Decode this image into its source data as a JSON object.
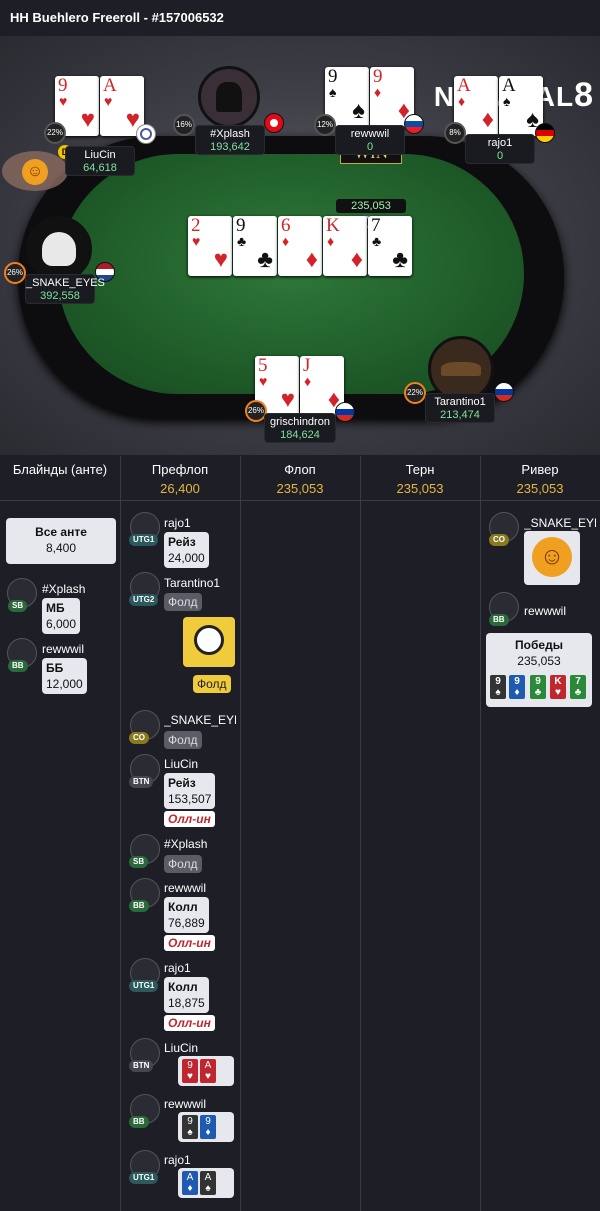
{
  "title": "HH Buehlero Freeroll - #157006532",
  "logo": {
    "text": "NATURAL",
    "digit": "8"
  },
  "table": {
    "win_label": "WIN",
    "pot": "235,053",
    "board": [
      {
        "rank": "2",
        "suit": "♥",
        "color": "red"
      },
      {
        "rank": "9",
        "suit": "♣",
        "color": "blk"
      },
      {
        "rank": "6",
        "suit": "♦",
        "color": "red"
      },
      {
        "rank": "K",
        "suit": "♦",
        "color": "red"
      },
      {
        "rank": "7",
        "suit": "♣",
        "color": "blk"
      }
    ],
    "players": [
      {
        "name": "LiuCin",
        "stack": "64,618",
        "pct": "22%",
        "cards": [
          {
            "rank": "9",
            "suit": "♥",
            "color": "red"
          },
          {
            "rank": "A",
            "suit": "♥",
            "color": "red"
          }
        ]
      },
      {
        "name": "#Xplash",
        "stack": "193,642",
        "pct": "16%"
      },
      {
        "name": "rewwwil",
        "stack": "0",
        "pct": "12%",
        "cards": [
          {
            "rank": "9",
            "suit": "♠",
            "color": "blk"
          },
          {
            "rank": "9",
            "suit": "♦",
            "color": "red"
          }
        ]
      },
      {
        "name": "rajo1",
        "stack": "0",
        "pct": "8%",
        "cards": [
          {
            "rank": "A",
            "suit": "♦",
            "color": "red"
          },
          {
            "rank": "A",
            "suit": "♠",
            "color": "blk"
          }
        ]
      },
      {
        "name": "_SNAKE_EYES",
        "stack": "392,558",
        "pct": "26%"
      },
      {
        "name": "Tarantino1",
        "stack": "213,474",
        "pct": "22%"
      },
      {
        "name": "grischindron",
        "stack": "184,624",
        "pct": "26%",
        "cards": [
          {
            "rank": "5",
            "suit": "♥",
            "color": "red"
          },
          {
            "rank": "J",
            "suit": "♦",
            "color": "red"
          }
        ]
      }
    ],
    "dealer": "D"
  },
  "streets": [
    {
      "label": "Блайнды (анте)",
      "amount": ""
    },
    {
      "label": "Префлоп",
      "amount": "26,400"
    },
    {
      "label": "Флоп",
      "amount": "235,053"
    },
    {
      "label": "Терн",
      "amount": "235,053"
    },
    {
      "label": "Ривер",
      "amount": "235,053"
    }
  ],
  "blinds": {
    "ante_label": "Все анте",
    "ante_value": "8,400",
    "sb": {
      "name": "#Xplash",
      "pos": "SB",
      "action": "МБ",
      "amount": "6,000"
    },
    "bb": {
      "name": "rewwwil",
      "pos": "BB",
      "action": "ББ",
      "amount": "12,000"
    }
  },
  "preflop": [
    {
      "name": "rajo1",
      "pos": "UTG1",
      "action": "Рейз",
      "amount": "24,000"
    },
    {
      "name": "Tarantino1",
      "pos": "UTG2",
      "fold": "Фолд"
    },
    {
      "timeout_fold": "Фолд"
    },
    {
      "name": "_SNAKE_EYES",
      "pos": "CO",
      "fold": "Фолд"
    },
    {
      "name": "LiuCin",
      "pos": "BTN",
      "action": "Рейз",
      "amount": "153,507",
      "allin": "Олл-ин"
    },
    {
      "name": "#Xplash",
      "pos": "SB",
      "fold": "Фолд"
    },
    {
      "name": "rewwwil",
      "pos": "BB",
      "action": "Колл",
      "amount": "76,889",
      "allin": "Олл-ин"
    },
    {
      "name": "rajo1",
      "pos": "UTG1",
      "action": "Колл",
      "amount": "18,875",
      "allin": "Олл-ин"
    },
    {
      "name": "LiuCin",
      "pos": "BTN",
      "cards": [
        "9",
        "A"
      ]
    },
    {
      "name": "rewwwil",
      "pos": "BB",
      "cards": [
        "9",
        "9"
      ]
    },
    {
      "name": "rajo1",
      "pos": "UTG1",
      "cards": [
        "A",
        "A"
      ]
    }
  ],
  "river": {
    "snake": {
      "name": "_SNAKE_EYES",
      "pos": "CO"
    },
    "winner": {
      "name": "rewwwil",
      "pos": "BB",
      "label": "Победы",
      "amount": "235,053"
    },
    "hand": [
      "9",
      "9",
      "9",
      "K",
      "7"
    ]
  },
  "colors": {
    "accent": "#e6b542",
    "felt": "#1f5c29",
    "stack": "#7fe39c",
    "allin": "#c0262e"
  }
}
